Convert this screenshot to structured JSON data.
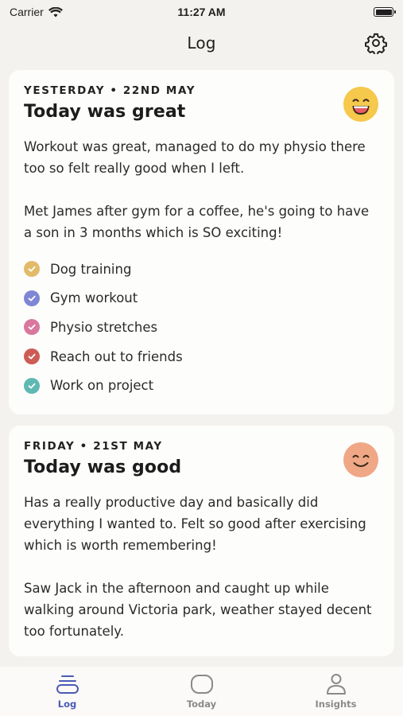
{
  "status_bar": {
    "carrier": "Carrier",
    "time": "11:27 AM"
  },
  "header": {
    "title": "Log",
    "settings_icon": "gear-icon"
  },
  "entries": [
    {
      "date": "YESTERDAY • 22ND MAY",
      "title": "Today was great",
      "mood": "grinning-face",
      "mood_color": "#f6c84b",
      "paragraphs": [
        "Workout was great, managed to do my physio there too so felt really good when I left.",
        "Met James after gym for a coffee, he's going to have a son in 3 months which is SO exciting!"
      ],
      "tasks": [
        {
          "label": "Dog training",
          "color": "#e2bb6a",
          "checked": true
        },
        {
          "label": "Gym workout",
          "color": "#7f86d6",
          "checked": true
        },
        {
          "label": "Physio stretches",
          "color": "#d9779e",
          "checked": true
        },
        {
          "label": "Reach out to friends",
          "color": "#cc5c55",
          "checked": true
        },
        {
          "label": "Work on project",
          "color": "#5fb9b2",
          "checked": true
        }
      ]
    },
    {
      "date": "FRIDAY • 21ST MAY",
      "title": "Today was good",
      "mood": "smiling-face",
      "mood_color": "#efa786",
      "paragraphs": [
        "Has a really productive day and basically did everything I wanted to. Felt so good after exercising which is worth remembering!",
        "Saw Jack in the afternoon and caught up while walking around Victoria park, weather stayed decent too fortunately."
      ]
    }
  ],
  "tab_bar": {
    "tabs": [
      {
        "label": "Log",
        "icon": "log-stack-icon",
        "active": true
      },
      {
        "label": "Today",
        "icon": "today-rounded-square-icon",
        "active": false
      },
      {
        "label": "Insights",
        "icon": "person-icon",
        "active": false
      }
    ],
    "active_color": "#4b5bb4",
    "inactive_color": "#8a8a8a"
  }
}
